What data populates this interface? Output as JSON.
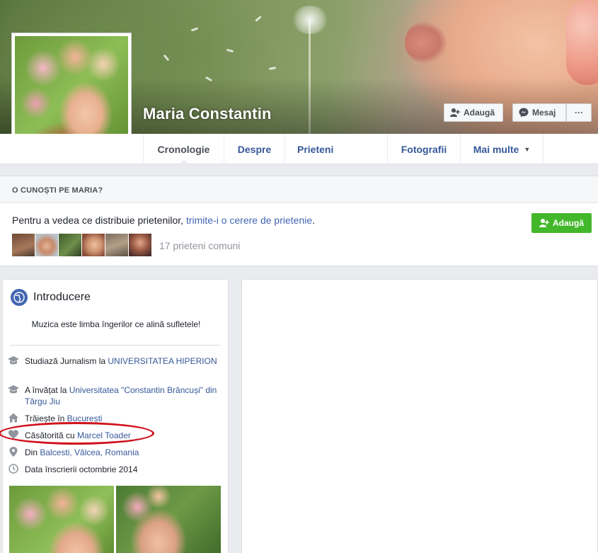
{
  "profile": {
    "name": "Maria Constantin"
  },
  "cover_actions": {
    "add_label": "Adaugă",
    "message_label": "Mesaj",
    "more_label": "···"
  },
  "tabs": [
    {
      "label": "Cronologie"
    },
    {
      "label": "Despre"
    },
    {
      "label": "Prieteni"
    },
    {
      "label": "Fotografii"
    },
    {
      "label": "Mai multe"
    }
  ],
  "know": {
    "header": "O CUNOȘTI PE MARIA?",
    "text_prefix": "Pentru a vedea ce distribuie prietenilor, ",
    "text_link": "trimite-i o cerere de prietenie",
    "text_suffix": ".",
    "mutual_friends": "17 prieteni comuni",
    "add_button": "Adaugă"
  },
  "intro": {
    "title": "Introducere",
    "bio": "Muzica este limba îngerilor ce alină sufletele!",
    "items": [
      {
        "icon": "graduation-cap-icon",
        "prefix": "Studiază Jurnalism la ",
        "link": "UNIVERSITATEA HIPERION",
        "suffix": ""
      },
      {
        "icon": "graduation-cap-icon",
        "prefix": "A învățat la ",
        "link": "Universitatea \"Constantin Brâncuși\" din Târgu Jiu",
        "suffix": ""
      },
      {
        "icon": "home-icon",
        "prefix": "Trăiește în ",
        "link": "București",
        "suffix": ""
      },
      {
        "icon": "heart-icon",
        "prefix": "Căsătorită cu ",
        "link": "Marcel Toader",
        "suffix": ""
      },
      {
        "icon": "location-pin-icon",
        "prefix": "Din ",
        "link": "Balcesti, Vâlcea, Romania",
        "suffix": ""
      },
      {
        "icon": "clock-icon",
        "prefix": "Data înscrierii octombrie 2014",
        "link": "",
        "suffix": ""
      }
    ]
  },
  "colors": {
    "link": "#365899",
    "green_button": "#42b72a",
    "highlight_ellipse": "#d0111d"
  }
}
